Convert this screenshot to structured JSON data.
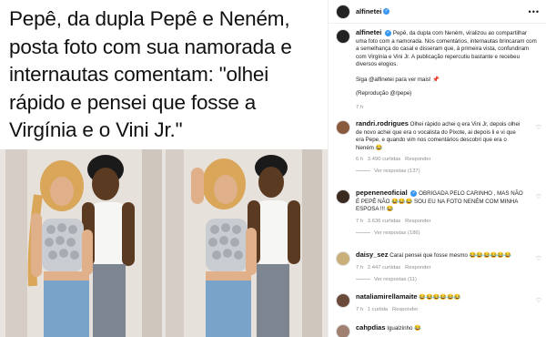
{
  "post": {
    "headline": "Pepê, da dupla Pepê e Neném, posta foto com sua namorada e internautas comentam: \"olhei rápido e pensei que fosse a Virgínia e o Vini Jr.\""
  },
  "caption": {
    "username": "alfinetei",
    "text": "Pepê, da dupla com Neném, viralizou ao compartilhar uma foto com a namorada. Nos comentários, internautas brincaram com a semelhança do casal e disseram que, à primeira vista, confundiram com Virgínia e Vini Jr. A publicação repercutiu bastante e recebeu diversos elogios.",
    "cta": "Siga @alfinetei para ver mais! 📌",
    "credit": "(Reprodução @/pepe)",
    "time": "7 h"
  },
  "comments": [
    {
      "username": "randri.rodrigues",
      "text": "Olhei rápido achei q era Vini Jr, depois olhei de novo achei que era o vocalista do Pixote, ai depois li e vi que era Pepe, e quando vim nos comentários descobri que era o Neném 😂",
      "time": "6 h",
      "likes": "3.490 curtidas",
      "reply": "Responder",
      "replies": "Ver respostas (137)"
    },
    {
      "username": "pepeneneoficial",
      "text": "OBRIGADA PELO CARINHO , MAS NÃO É PEPÊ NÃO 😂😂😂 SOU EU NA FOTO NENÉM COM MINHA ESPOSA !!! 😂",
      "time": "7 h",
      "likes": "3.636 curtidas",
      "reply": "Responder",
      "replies": "Ver respostas (186)"
    },
    {
      "username": "daisy_sez",
      "text": "Caraí pensei que fosse mesmo 😂😂😂😂😂😂",
      "time": "7 h",
      "likes": "2.447 curtidas",
      "reply": "Responder",
      "replies": "Ver respostas (11)"
    },
    {
      "username": "nataliamirellamaite",
      "text": "😂😂😂😂😂😂",
      "time": "7 h",
      "likes": "1 curtida",
      "reply": "Responder"
    },
    {
      "username": "cahpdias",
      "text": "Igualzinho 😂"
    }
  ],
  "icons": {
    "more": "more-options-icon",
    "like": "heart-icon",
    "verified": "verified-badge-icon"
  }
}
